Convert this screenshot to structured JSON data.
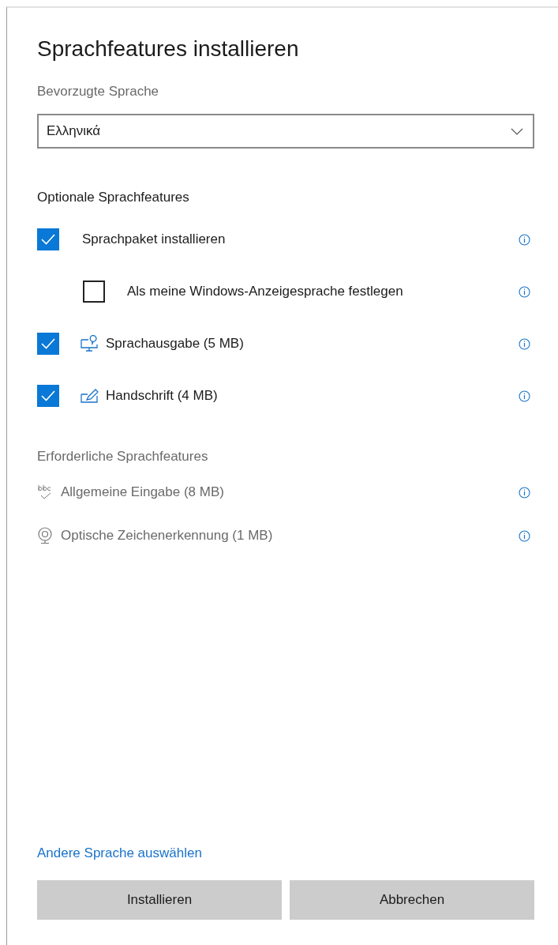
{
  "dialog": {
    "title": "Sprachfeatures installieren"
  },
  "preferred_language": {
    "label": "Bevorzugte Sprache",
    "value": "Ελληνικά"
  },
  "optional_features": {
    "heading": "Optionale Sprachfeatures",
    "items": [
      {
        "label": "Sprachpaket installieren",
        "checked": true,
        "children": [
          {
            "label": "Als meine Windows-Anzeigesprache festlegen",
            "checked": false
          }
        ]
      },
      {
        "label": "Sprachausgabe (5 MB)",
        "checked": true,
        "kind": "speech"
      },
      {
        "label": "Handschrift (4 MB)",
        "checked": true,
        "kind": "handwriting"
      }
    ]
  },
  "required_features": {
    "heading": "Erforderliche Sprachfeatures",
    "items": [
      {
        "label": "Allgemeine Eingabe (8 MB)",
        "kind": "typing"
      },
      {
        "label": "Optische Zeichenerkennung (1 MB)",
        "kind": "ocr"
      }
    ]
  },
  "link": "Andere Sprache auswählen",
  "buttons": [
    "Installieren",
    "Abbrechen"
  ]
}
